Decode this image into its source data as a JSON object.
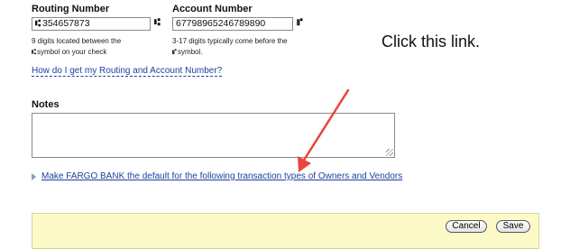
{
  "routing": {
    "label": "Routing Number",
    "value": "354657873",
    "glyph": "⑆",
    "hint_line1": "9 digits located between the",
    "hint_glyph": "⑆",
    "hint_line2": "symbol on your check"
  },
  "account": {
    "label": "Account Number",
    "value": "67798965246789890",
    "side_glyph": "⑈",
    "hint_line1": "3-17 digits typically come before the",
    "hint_glyph": "⑈",
    "hint_line2": "symbol."
  },
  "callout": "Click this link.",
  "help_link": "How do I get my Routing and Account Number?",
  "notes": {
    "label": "Notes",
    "value": ""
  },
  "default_link": "Make FARGO BANK the default for the following transaction types of Owners and Vendors",
  "buttons": {
    "cancel": "Cancel",
    "save": "Save"
  },
  "colors": {
    "link": "#1d3fa0",
    "arrow": "#e8453c",
    "footer_bg": "#fcfbc8"
  }
}
